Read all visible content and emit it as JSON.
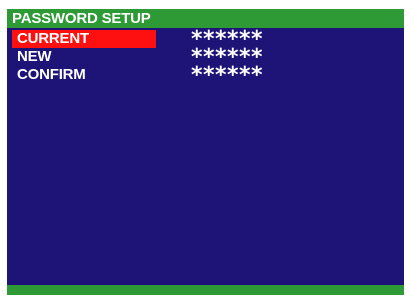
{
  "title": "PASSWORD SETUP",
  "colors": {
    "background": "#1e1478",
    "title_bar": "#2e9a35",
    "selection": "#ff1010",
    "text": "#ffffff"
  },
  "rows": [
    {
      "label": "CURRENT",
      "value": "******",
      "selected": true
    },
    {
      "label": "NEW",
      "value": "******",
      "selected": false
    },
    {
      "label": "CONFIRM",
      "value": "******",
      "selected": false
    }
  ]
}
